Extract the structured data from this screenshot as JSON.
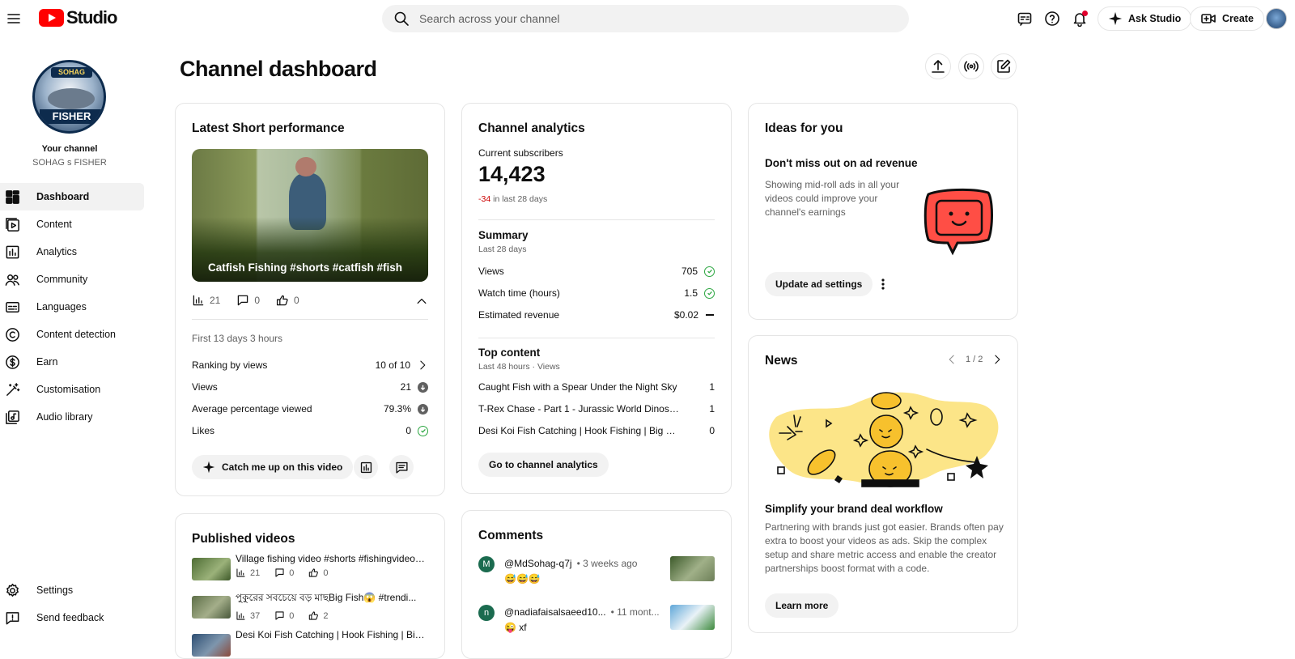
{
  "app": {
    "brand": "Studio",
    "menu_icon": "hamburger-icon"
  },
  "search": {
    "placeholder": "Search across your channel"
  },
  "header": {
    "ask_studio_label": "Ask Studio",
    "create_label": "Create",
    "icons": [
      "subtitles-icon",
      "help-icon",
      "notifications-icon"
    ]
  },
  "sidebar": {
    "avatar_top_text": "SOHAG",
    "avatar_bottom_text": "FISHER",
    "your_channel": "Your channel",
    "channel_name": "SOHAG s FISHER",
    "items": [
      {
        "label": "Dashboard",
        "icon": "dashboard-icon",
        "active": true
      },
      {
        "label": "Content",
        "icon": "content-icon"
      },
      {
        "label": "Analytics",
        "icon": "analytics-icon"
      },
      {
        "label": "Community",
        "icon": "community-icon"
      },
      {
        "label": "Languages",
        "icon": "languages-icon"
      },
      {
        "label": "Content detection",
        "icon": "copyright-icon"
      },
      {
        "label": "Earn",
        "icon": "earn-icon"
      },
      {
        "label": "Customisation",
        "icon": "magic-wand-icon"
      },
      {
        "label": "Audio library",
        "icon": "audio-library-icon"
      }
    ],
    "bottom": [
      {
        "label": "Settings",
        "icon": "settings-icon"
      },
      {
        "label": "Send feedback",
        "icon": "feedback-icon"
      }
    ]
  },
  "page": {
    "title": "Channel dashboard"
  },
  "latest_short": {
    "title": "Latest Short performance",
    "video_title": "Catfish Fishing #shorts #catfish #fish",
    "views": "21",
    "comments": "0",
    "likes": "0",
    "period": "First 13 days 3 hours",
    "ranking_label": "Ranking by views",
    "ranking_value": "10 of 10",
    "views_label": "Views",
    "views_value": "21",
    "avg_label": "Average percentage viewed",
    "avg_value": "79.3%",
    "likes_label": "Likes",
    "likes_value": "0",
    "catch_up_label": "Catch me up on this video"
  },
  "analytics": {
    "title": "Channel analytics",
    "subs_label": "Current subscribers",
    "subs_value": "14,423",
    "subs_change": "-34",
    "subs_change_suffix": "in last 28 days",
    "summary_title": "Summary",
    "summary_period": "Last 28 days",
    "rows": [
      {
        "label": "Views",
        "value": "705",
        "status": "up"
      },
      {
        "label": "Watch time (hours)",
        "value": "1.5",
        "status": "up"
      },
      {
        "label": "Estimated revenue",
        "value": "$0.02",
        "status": "flat"
      }
    ],
    "top_title": "Top content",
    "top_period": "Last 48 hours · Views",
    "top_items": [
      {
        "title": "Caught Fish with a Spear Under the Night Sky",
        "views": "1"
      },
      {
        "title": "T-Rex Chase - Part 1 - Jurassic World Dinosaur Fan ...",
        "views": "1"
      },
      {
        "title": "Desi Koi Fish Catching | Hook Fishing | Big Koi Fish ...",
        "views": "0"
      }
    ],
    "go_label": "Go to channel analytics"
  },
  "ideas": {
    "title": "Ideas for you",
    "headline": "Don't miss out on ad revenue",
    "body": "Showing mid-roll ads in all your videos could improve your channel's earnings",
    "button": "Update ad settings"
  },
  "news": {
    "title": "News",
    "pager": "1 / 2",
    "headline": "Simplify your brand deal workflow",
    "body": "Partnering with brands just got easier. Brands often pay extra to boost your videos as ads. Skip the complex setup and share metric access and enable the creator partnerships boost format with a code.",
    "button": "Learn more"
  },
  "published": {
    "title": "Published videos",
    "videos": [
      {
        "title": "Village fishing video #shorts #fishingvideo ...",
        "views": "21",
        "comments": "0",
        "likes": "0"
      },
      {
        "title": "পুকুরের সবচেয়ে বড় মাছBig Fish😱 #trendi...",
        "views": "37",
        "comments": "0",
        "likes": "2"
      },
      {
        "title": "Desi Koi Fish Catching | Hook Fishing | Big ..."
      }
    ]
  },
  "comments": {
    "title": "Comments",
    "items": [
      {
        "initial": "M",
        "user": "@MdSohag-q7j",
        "time": "• 3 weeks ago",
        "text": "😅😅😅",
        "color": "#1b6b4f"
      },
      {
        "initial": "n",
        "user": "@nadiafaisalsaeed10...",
        "time": "• 11 mont...",
        "text": "😜 xf",
        "color": "#1b6b4f"
      }
    ]
  },
  "colors": {
    "accent_red": "#ff0000",
    "positive": "#2ba640",
    "negative": "#cc0000"
  }
}
